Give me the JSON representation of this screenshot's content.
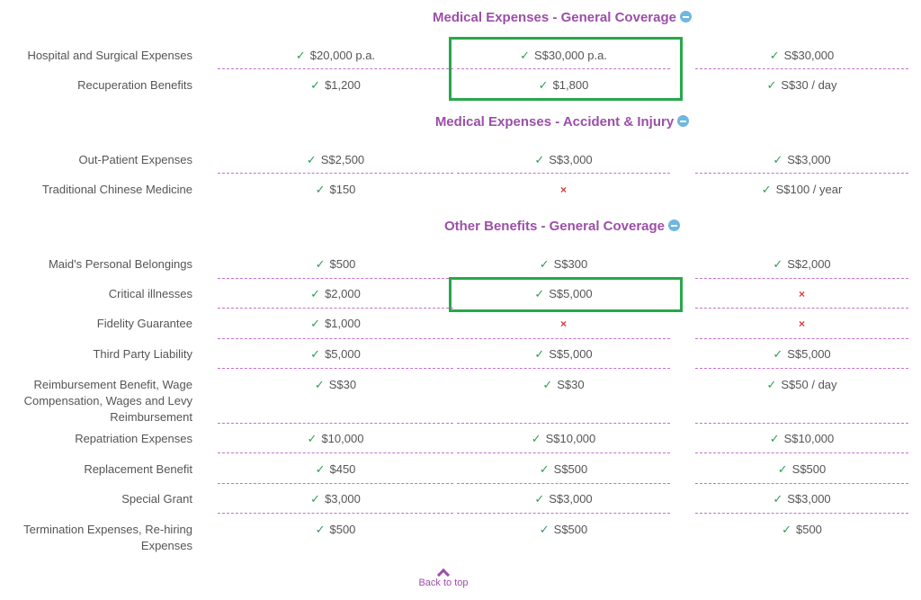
{
  "sections": [
    {
      "title": "Medical Expenses - General Coverage",
      "rows": [
        {
          "label": "Hospital and Surgical Expenses",
          "values": [
            "$20,000 p.a.",
            "S$30,000 p.a.",
            "S$30,000"
          ]
        },
        {
          "label": "Recuperation Benefits",
          "values": [
            "$1,200",
            "$1,800",
            "S$30 / day"
          ]
        }
      ]
    },
    {
      "title": "Medical Expenses - Accident & Injury",
      "rows": [
        {
          "label": "Out-Patient Expenses",
          "values": [
            "S$2,500",
            "S$3,000",
            "S$3,000"
          ]
        },
        {
          "label": "Traditional Chinese Medicine",
          "values": [
            "$150",
            "×",
            "S$100 / year"
          ]
        }
      ]
    },
    {
      "title": "Other Benefits - General Coverage",
      "rows": [
        {
          "label": "Maid's Personal Belongings",
          "values": [
            "$500",
            "S$300",
            "S$2,000"
          ]
        },
        {
          "label": "Critical illnesses",
          "values": [
            "$2,000",
            "S$5,000",
            "×"
          ]
        },
        {
          "label": "Fidelity Guarantee",
          "values": [
            "$1,000",
            "×",
            "×"
          ]
        },
        {
          "label": "Third Party Liability",
          "values": [
            "$5,000",
            "S$5,000",
            "S$5,000"
          ]
        },
        {
          "label": "Reimbursement Benefit, Wage Compensation, Wages and Levy Reimbursement",
          "values": [
            "S$30",
            "S$30",
            "S$50 / day"
          ]
        },
        {
          "label": "Repatriation Expenses",
          "values": [
            "$10,000",
            "S$10,000",
            "S$10,000"
          ]
        },
        {
          "label": "Replacement Benefit",
          "values": [
            "$450",
            "S$500",
            "S$500"
          ]
        },
        {
          "label": "Special Grant",
          "values": [
            "$3,000",
            "S$3,000",
            "S$3,000"
          ]
        },
        {
          "label": "Termination Expenses, Re-hiring Expenses",
          "values": [
            "$500",
            "S$500",
            "$500"
          ]
        }
      ]
    }
  ],
  "icons": {
    "check": "check-icon",
    "cross": "cross-icon",
    "collapse": "minus-circle-icon",
    "back": "chevron-up-icon"
  },
  "footer": {
    "back_to_top": "Back to top"
  },
  "colors": {
    "section_title": "#9b4fa8",
    "check": "#2f9e56",
    "cross": "#d93a3a",
    "divider": "#c56fd0",
    "highlight": "#27a84a",
    "collapse_icon": "#6fb7de"
  }
}
